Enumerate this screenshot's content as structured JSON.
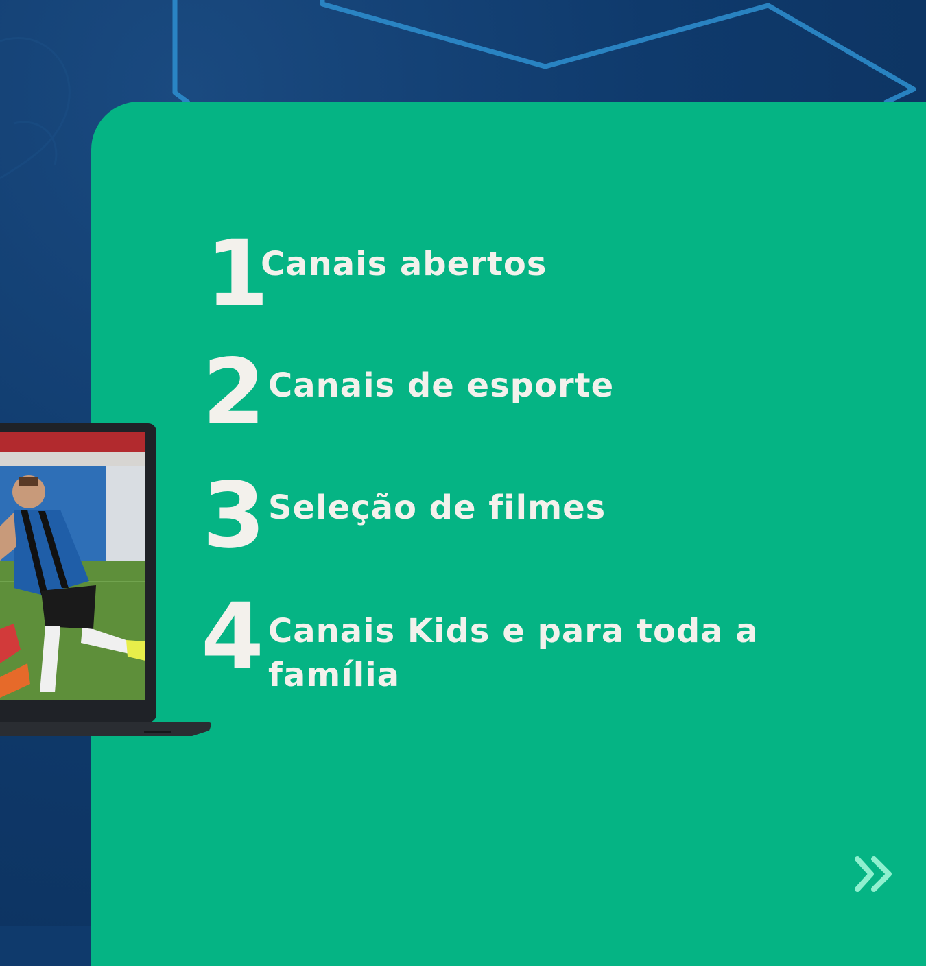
{
  "items": [
    {
      "number": "1",
      "label": "Canais abertos"
    },
    {
      "number": "2",
      "label": "Canais de esporte"
    },
    {
      "number": "3",
      "label": "Seleção de filmes"
    },
    {
      "number": "4",
      "label": "Canais Kids e para toda a família"
    }
  ],
  "icons": {
    "next": "double-chevron-right-icon",
    "laptop": "laptop-with-soccer-match-image"
  },
  "colors": {
    "background": "#0f3a6c",
    "card": "#05b484",
    "text": "#f3f1ec",
    "accent_lines": "#2e8fd0",
    "next_icon": "#8ff0cf"
  }
}
